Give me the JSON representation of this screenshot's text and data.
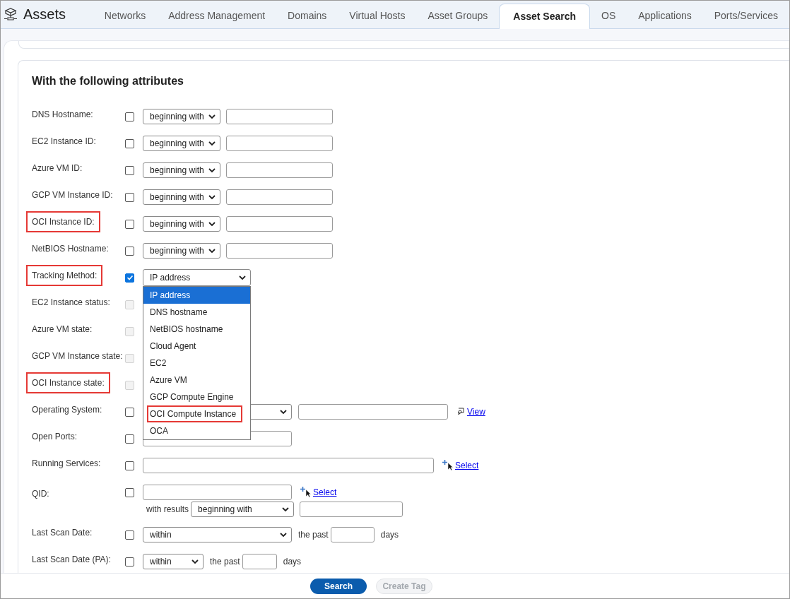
{
  "app": {
    "title": "Assets"
  },
  "tabs": [
    {
      "label": "Networks",
      "selected": false
    },
    {
      "label": "Address Management",
      "selected": false
    },
    {
      "label": "Domains",
      "selected": false
    },
    {
      "label": "Virtual Hosts",
      "selected": false
    },
    {
      "label": "Asset Groups",
      "selected": false
    },
    {
      "label": "Asset Search",
      "selected": true
    },
    {
      "label": "OS",
      "selected": false
    },
    {
      "label": "Applications",
      "selected": false
    },
    {
      "label": "Ports/Services",
      "selected": false
    }
  ],
  "section": {
    "heading": "With the following attributes"
  },
  "rows": [
    {
      "kind": "match",
      "label": "DNS Hostname:",
      "highlighted": false,
      "checked": false,
      "disabled": false,
      "operator": "beginning with"
    },
    {
      "kind": "match",
      "label": "EC2 Instance ID:",
      "highlighted": false,
      "checked": false,
      "disabled": false,
      "operator": "beginning with"
    },
    {
      "kind": "match",
      "label": "Azure VM ID:",
      "highlighted": false,
      "checked": false,
      "disabled": false,
      "operator": "beginning with"
    },
    {
      "kind": "match",
      "label": "GCP VM Instance ID:",
      "highlighted": false,
      "checked": false,
      "disabled": false,
      "operator": "beginning with"
    },
    {
      "kind": "match",
      "label": "OCI Instance ID:",
      "highlighted": true,
      "checked": false,
      "disabled": false,
      "operator": "beginning with"
    },
    {
      "kind": "match",
      "label": "NetBIOS Hostname:",
      "highlighted": false,
      "checked": false,
      "disabled": false,
      "operator": "beginning with"
    },
    {
      "kind": "tracking",
      "label": "Tracking Method:",
      "highlighted": true,
      "checked": true,
      "disabled": false,
      "operator": "IP address"
    },
    {
      "kind": "state",
      "label": "EC2 Instance status:",
      "highlighted": false,
      "checked": false,
      "disabled": true
    },
    {
      "kind": "state",
      "label": "Azure VM state:",
      "highlighted": false,
      "checked": false,
      "disabled": true
    },
    {
      "kind": "state",
      "label": "GCP VM Instance state:",
      "highlighted": false,
      "checked": false,
      "disabled": true
    },
    {
      "kind": "state",
      "label": "OCI Instance state:",
      "highlighted": true,
      "checked": false,
      "disabled": true
    },
    {
      "kind": "os",
      "label": "Operating System:",
      "highlighted": false,
      "checked": false,
      "disabled": false,
      "link": "View"
    },
    {
      "kind": "ports",
      "label": "Open Ports:",
      "highlighted": false,
      "checked": false,
      "disabled": false
    },
    {
      "kind": "services",
      "label": "Running Services:",
      "highlighted": false,
      "checked": false,
      "disabled": false,
      "link": "Select"
    },
    {
      "kind": "qid",
      "label": "QID:",
      "highlighted": false,
      "checked": false,
      "disabled": false,
      "link": "Select",
      "sub_label": "with results",
      "operator": "beginning with"
    },
    {
      "kind": "date",
      "label": "Last Scan Date:",
      "highlighted": false,
      "checked": false,
      "disabled": false,
      "compact": false,
      "operator": "within",
      "middle": "the past",
      "unit": "days"
    },
    {
      "kind": "date",
      "label": "Last Scan Date (PA):",
      "highlighted": false,
      "checked": false,
      "disabled": false,
      "compact": true,
      "operator": "within",
      "middle": "the past",
      "unit": "days"
    }
  ],
  "dropdown": {
    "options": [
      {
        "label": "IP address",
        "selected": true,
        "highlighted": false
      },
      {
        "label": "DNS hostname",
        "selected": false,
        "highlighted": false
      },
      {
        "label": "NetBIOS hostname",
        "selected": false,
        "highlighted": false
      },
      {
        "label": "Cloud Agent",
        "selected": false,
        "highlighted": false
      },
      {
        "label": "EC2",
        "selected": false,
        "highlighted": false
      },
      {
        "label": "Azure VM",
        "selected": false,
        "highlighted": false
      },
      {
        "label": "GCP Compute Engine",
        "selected": false,
        "highlighted": false
      },
      {
        "label": "OCI Compute Instance",
        "selected": false,
        "highlighted": true
      },
      {
        "label": "OCA",
        "selected": false,
        "highlighted": false
      }
    ]
  },
  "footer": {
    "buttons": [
      {
        "label": "Search",
        "disabled": false
      },
      {
        "label": "Create Tag",
        "disabled": true
      }
    ]
  }
}
